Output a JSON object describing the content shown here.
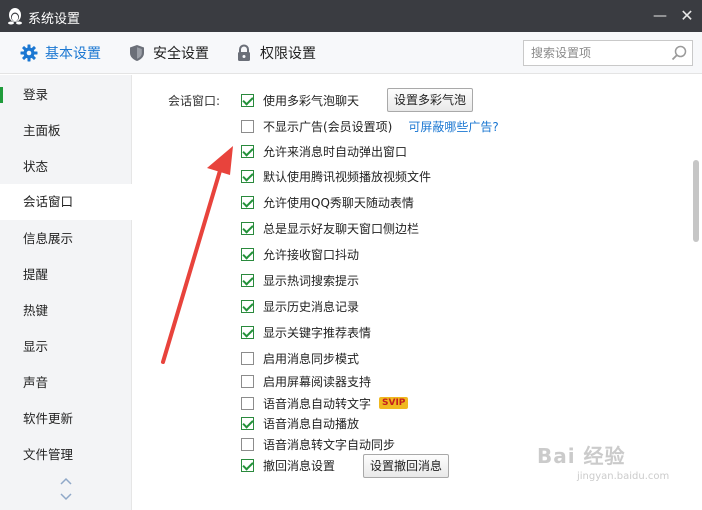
{
  "window": {
    "title": "系统设置",
    "minimize": "—",
    "close": "✕"
  },
  "tabs": [
    {
      "label": "基本设置",
      "icon": "gear-icon",
      "active": true
    },
    {
      "label": "安全设置",
      "icon": "shield-icon",
      "active": false
    },
    {
      "label": "权限设置",
      "icon": "lock-icon",
      "active": false
    }
  ],
  "search": {
    "placeholder": "搜索设置项"
  },
  "sidebar": {
    "items": [
      "登录",
      "主面板",
      "状态",
      "会话窗口",
      "信息展示",
      "提醒",
      "热键",
      "显示",
      "声音",
      "软件更新",
      "文件管理"
    ],
    "active_index": 3
  },
  "content": {
    "section_label": "会话窗口:",
    "options": [
      {
        "label": "使用多彩气泡聊天",
        "checked": true,
        "button": "设置多彩气泡"
      },
      {
        "label": "不显示广告(会员设置项)",
        "checked": false,
        "link": "可屏蔽哪些广告?"
      },
      {
        "label": "允许来消息时自动弹出窗口",
        "checked": true
      },
      {
        "label": "默认使用腾讯视频播放视频文件",
        "checked": true
      },
      {
        "label": "允许使用QQ秀聊天随动表情",
        "checked": true
      },
      {
        "label": "总是显示好友聊天窗口侧边栏",
        "checked": true
      },
      {
        "label": "允许接收窗口抖动",
        "checked": true
      },
      {
        "label": "显示热词搜索提示",
        "checked": true
      },
      {
        "label": "显示历史消息记录",
        "checked": true
      },
      {
        "label": "显示关键字推荐表情",
        "checked": true
      },
      {
        "label": "启用消息同步模式",
        "checked": false
      },
      {
        "label": "启用屏幕阅读器支持",
        "checked": false
      },
      {
        "label": "语音消息自动转文字",
        "checked": false,
        "badge": "SVIP"
      },
      {
        "label": "语音消息自动播放",
        "checked": true
      },
      {
        "label": "语音消息转文字自动同步",
        "checked": false
      },
      {
        "label": "撤回消息设置",
        "checked": true,
        "button": "设置撤回消息"
      }
    ]
  },
  "watermark": {
    "main": "Bai 经验",
    "sub": "jingyan.baidu.com"
  },
  "colors": {
    "titlebar": "#3a3c41",
    "accent": "#1b77d2",
    "check": "#23923a",
    "arrow": "#e8433c"
  }
}
